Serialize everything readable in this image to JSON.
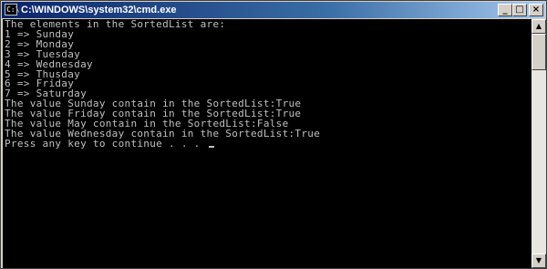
{
  "window": {
    "title": "C:\\WINDOWS\\system32\\cmd.exe",
    "icon_glyph": "C:\\",
    "buttons": {
      "minimize": "_",
      "maximize": "□",
      "close": "×"
    }
  },
  "console": {
    "lines": [
      "The elements in the SortedList are:",
      "1 => Sunday",
      "2 => Monday",
      "3 => Tuesday",
      "4 => Wednesday",
      "5 => Thusday",
      "6 => Friday",
      "7 => Saturday",
      "The value Sunday contain in the SortedList:True",
      "The value Friday contain in the SortedList:True",
      "The value May contain in the SortedList:False",
      "The value Wednesday contain in the SortedList:True",
      "Press any key to continue . . . "
    ]
  },
  "scrollbar": {
    "up_glyph": "▲",
    "down_glyph": "▼"
  },
  "colors": {
    "titlebar_start": "#0a246a",
    "console_bg": "#000000",
    "console_text": "#c0c0c0"
  }
}
